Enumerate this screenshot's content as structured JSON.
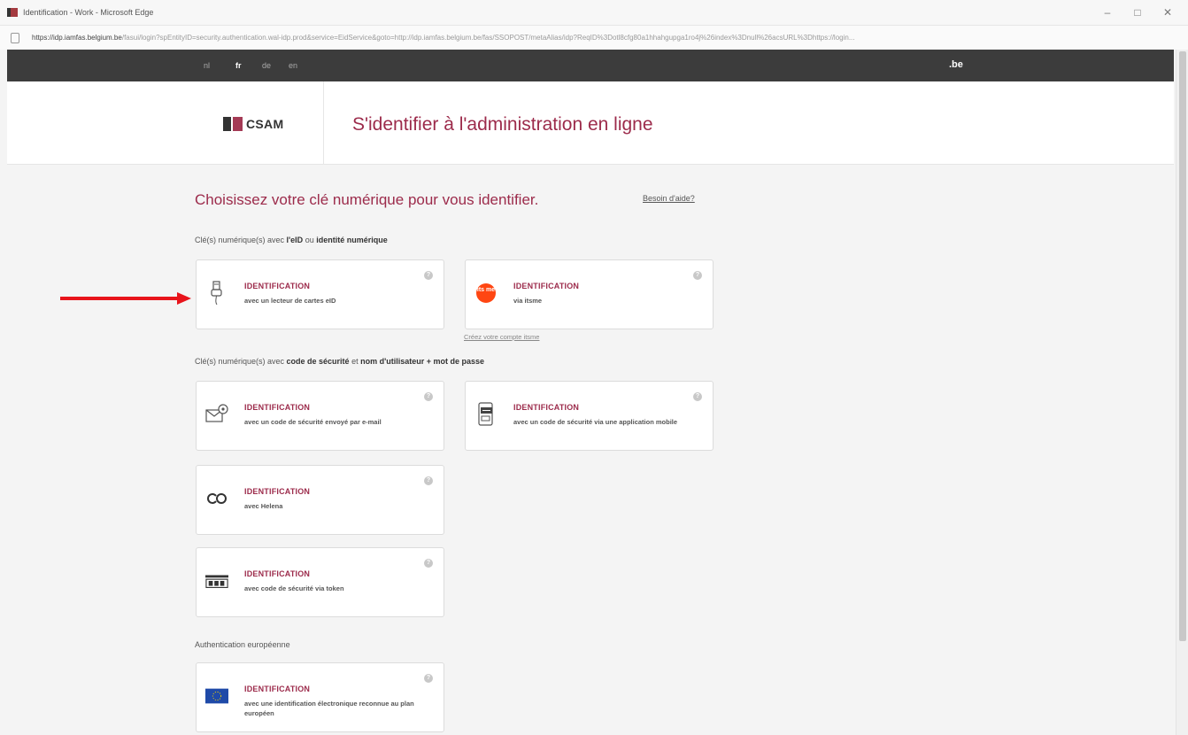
{
  "window": {
    "title": "Identification - Work - Microsoft Edge",
    "controls": [
      "–",
      "□",
      "✕"
    ]
  },
  "address": {
    "host": "https://idp.iamfas.belgium.be",
    "path": "/fasui/login?spEntityID=security.authentication.wal-idp.prod&service=EidService&goto=http://idp.iamfas.belgium.be/fas/SSOPOST/metaAlias/idp?ReqID%3Dotl8cfg80a1hhahgupga1ro4j%26index%3Dnull%26acsURL%3Dhttps://login..."
  },
  "lang": [
    "nl",
    "fr",
    "de",
    "en"
  ],
  "lang_active": "fr",
  "brand": ".be",
  "header": {
    "logo_text": "CSAM",
    "title": "S'identifier à l'administration en ligne"
  },
  "main": {
    "title": "Choisissez votre clé numérique pour vous identifier.",
    "help": "Besoin d'aide?"
  },
  "sections": {
    "s1": {
      "pre": "Clé(s) numérique(s) avec ",
      "b1": "l'eID",
      "mid": " ou ",
      "b2": "identité numérique"
    },
    "s2": {
      "pre": "Clé(s) numérique(s) avec ",
      "b1": "code de sécurité",
      "mid": " et ",
      "b2": "nom d'utilisateur + mot de passe"
    },
    "s3": {
      "text": "Authentication européenne"
    }
  },
  "cards": {
    "eid": {
      "head": "IDENTIFICATION",
      "sub": "avec un lecteur de cartes eID",
      "icon": "card-reader-icon"
    },
    "itsme": {
      "head": "IDENTIFICATION",
      "sub": "via itsme",
      "icon": "itsme-icon",
      "icon_text": "its me"
    },
    "email": {
      "head": "IDENTIFICATION",
      "sub": "avec un code de sécurité envoyé par e-mail",
      "icon": "email-icon"
    },
    "mobile": {
      "head": "IDENTIFICATION",
      "sub": "avec un code de sécurité via une application mobile",
      "icon": "mobile-app-icon"
    },
    "helena": {
      "head": "IDENTIFICATION",
      "sub": "avec Helena",
      "icon": "helena-icon"
    },
    "token": {
      "head": "IDENTIFICATION",
      "sub": "avec code de sécurité via token",
      "icon": "token-icon"
    },
    "eu": {
      "head": "IDENTIFICATION",
      "sub": "avec une identification électronique reconnue au plan européen",
      "icon": "eu-flag-icon"
    }
  },
  "itsme_link": "Créez votre compte itsme",
  "help_glyph": "?",
  "colors": {
    "accent": "#9c2b4b",
    "arrow": "#e8141b",
    "topbar": "#3c3c3c"
  }
}
